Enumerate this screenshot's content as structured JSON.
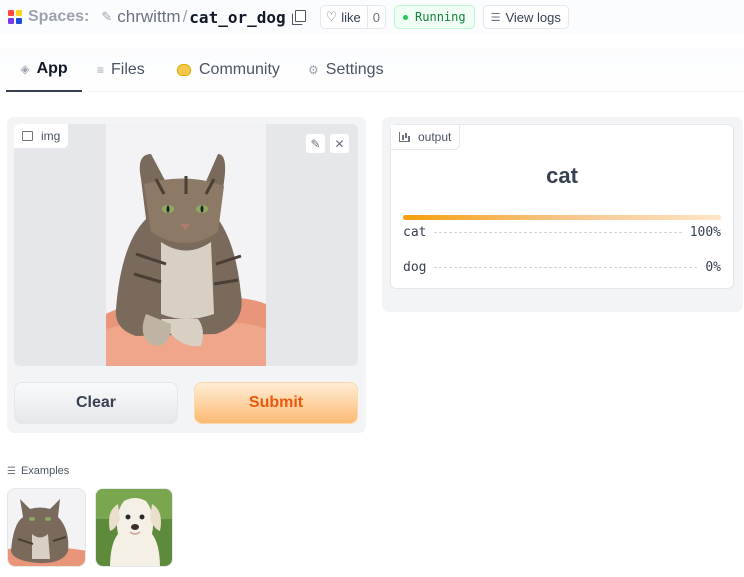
{
  "header": {
    "spaces_label": "Spaces:",
    "owner": "chrwittm",
    "separator": "/",
    "repo": "cat_or_dog",
    "like_label": "like",
    "like_count": "0",
    "status": "Running",
    "view_logs": "View logs",
    "status_color": "#22c55e",
    "logo_colors": [
      "#ff4a3d",
      "#ffd21e",
      "#7c3aed",
      "#1d4ed8"
    ]
  },
  "tabs": [
    {
      "label": "App",
      "icon": "cube-icon"
    },
    {
      "label": "Files",
      "icon": "files-icon"
    },
    {
      "label": "Community",
      "icon": "community-icon"
    },
    {
      "label": "Settings",
      "icon": "gear-icon"
    }
  ],
  "input": {
    "label": "img",
    "clear_label": "Clear",
    "submit_label": "Submit",
    "accent": "#ea580c"
  },
  "output": {
    "label": "output",
    "prediction": "cat",
    "confidences": [
      {
        "label": "cat",
        "value": "100%"
      },
      {
        "label": "dog",
        "value": "0%"
      }
    ]
  },
  "examples": {
    "label": "Examples",
    "items": [
      "tabby-cat-image",
      "labrador-puppy-image"
    ]
  }
}
